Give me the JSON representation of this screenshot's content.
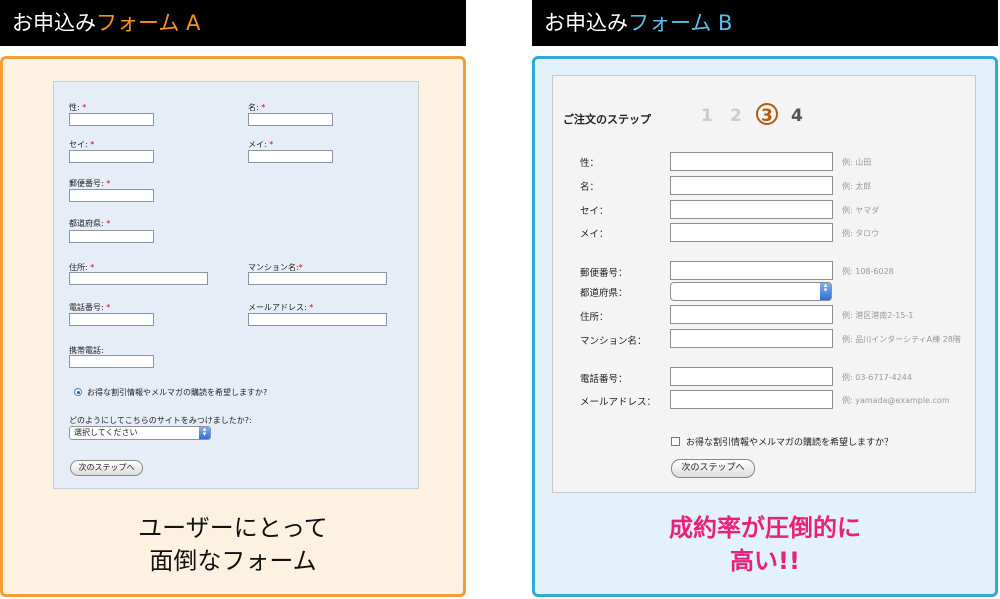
{
  "headerA": {
    "prefix": "お申込み",
    "accent": "フォーム A",
    "accent_color": "#f7941d"
  },
  "headerB": {
    "prefix": "お申込み",
    "accent": "フォーム B",
    "accent_color": "#5bc0e8"
  },
  "formA": {
    "last_name": "性:",
    "first_name": "名:",
    "last_kana": "セイ:",
    "first_kana": "メイ:",
    "postal": "郵便番号:",
    "prefecture": "都道府県:",
    "address": "住所:",
    "building": "マンション名:",
    "phone": "電話番号:",
    "email": "メールアドレス:",
    "mobile": "携帯電話:",
    "required_mark": "*",
    "newsletter": "お得な割引情報やメルマガの購読を希望しますか?",
    "newsletter_selected": true,
    "how_found": "どのようにしてこちらのサイトをみつけましたか?:",
    "how_found_select": "選択してください",
    "next": "次のステップへ"
  },
  "captionA": {
    "line1": "ユーザーにとって",
    "line2": "面倒なフォーム"
  },
  "formB": {
    "steps_title": "ご注文のステップ",
    "steps": [
      "1",
      "2",
      "3",
      "4"
    ],
    "current_step": 3,
    "fields": [
      {
        "label": "性：",
        "example": "例: 山田"
      },
      {
        "label": "名：",
        "example": "例: 太郎"
      },
      {
        "label": "セイ：",
        "example": "例: ヤマダ"
      },
      {
        "label": "メイ：",
        "example": "例: タロウ"
      },
      {
        "label": "郵便番号：",
        "example": "例: 108-6028"
      },
      {
        "label": "都道府県：",
        "example": ""
      },
      {
        "label": "住所：",
        "example": "例: 港区港南2-15-1"
      },
      {
        "label": "マンション名：",
        "example": "例: 品川インターシティA棟 28階"
      },
      {
        "label": "電話番号：",
        "example": "例: 03-6717-4244"
      },
      {
        "label": "メールアドレス：",
        "example": "例: yamada@example.com"
      }
    ],
    "newsletter": "お得な割引情報やメルマガの購読を希望しますか？",
    "newsletter_checked": false,
    "next": "次のステップへ"
  },
  "captionB": {
    "line1": "成約率が圧倒的に",
    "line2": "高い!!",
    "color": "#e8217a"
  }
}
